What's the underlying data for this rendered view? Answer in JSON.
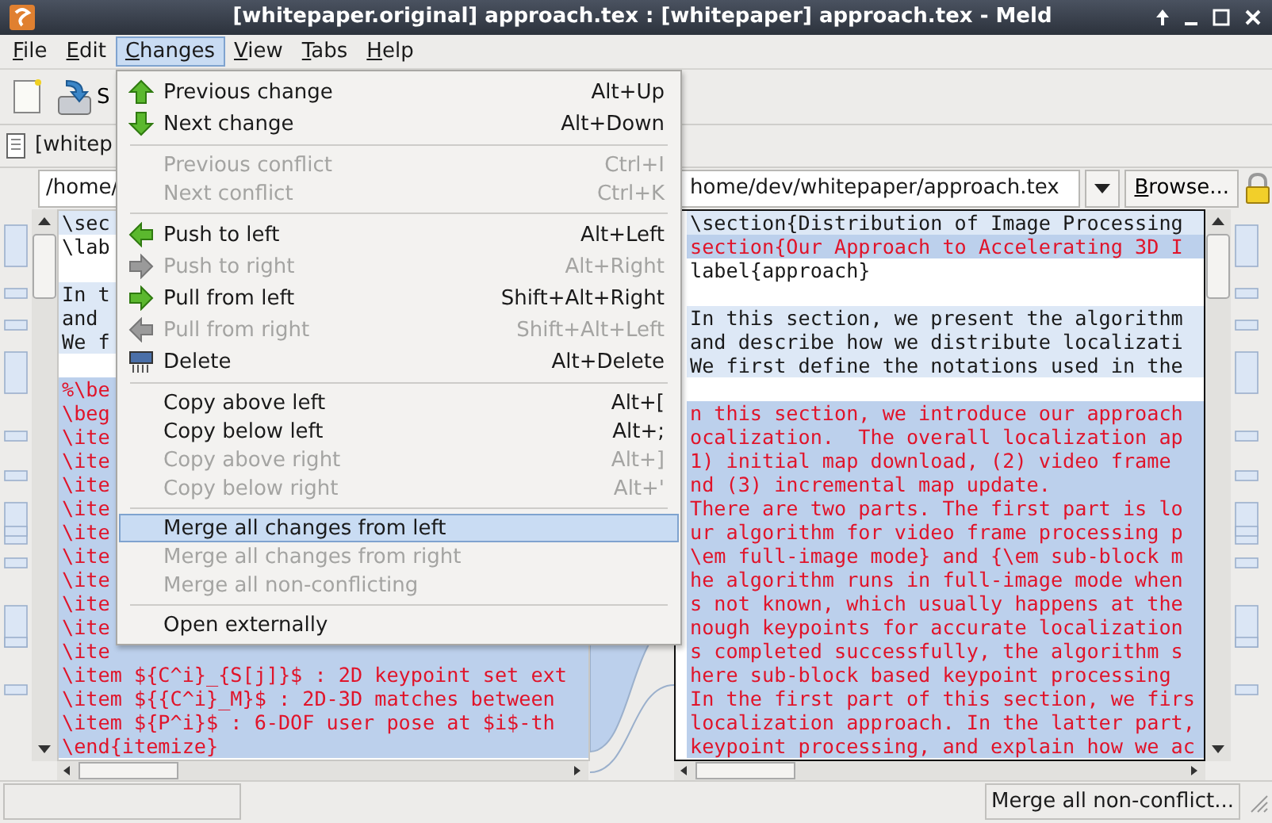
{
  "window": {
    "title": "[whitepaper.original] approach.tex : [whitepaper] approach.tex - Meld"
  },
  "menubar": [
    {
      "label": "File",
      "selected": false
    },
    {
      "label": "Edit",
      "selected": false
    },
    {
      "label": "Changes",
      "selected": true
    },
    {
      "label": "View",
      "selected": false
    },
    {
      "label": "Tabs",
      "selected": false
    },
    {
      "label": "Help",
      "selected": false
    }
  ],
  "toolbar": {
    "save_label": "S"
  },
  "tab": {
    "label": "[whitep"
  },
  "left_pane": {
    "path": "/home/",
    "lines": [
      {
        "kind": "modified",
        "text": "\\sec"
      },
      {
        "kind": "plain",
        "text": "\\lab"
      },
      {
        "kind": "blank"
      },
      {
        "kind": "modified",
        "text": "In t"
      },
      {
        "kind": "modified",
        "text": "and"
      },
      {
        "kind": "modified",
        "text": "We f"
      },
      {
        "kind": "blank"
      },
      {
        "kind": "changed",
        "text": "%\\be"
      },
      {
        "kind": "changed",
        "text": "\\beg"
      },
      {
        "kind": "changed",
        "text": "\\ite"
      },
      {
        "kind": "changed",
        "text": "\\ite"
      },
      {
        "kind": "changed",
        "text": "\\ite"
      },
      {
        "kind": "changed",
        "text": "\\ite"
      },
      {
        "kind": "changed",
        "text": "\\ite"
      },
      {
        "kind": "changed",
        "text": "\\ite"
      },
      {
        "kind": "changed",
        "text": "\\ite"
      },
      {
        "kind": "changed",
        "text": "\\ite"
      },
      {
        "kind": "changed",
        "text": "\\ite"
      },
      {
        "kind": "changed",
        "text": "\\ite"
      },
      {
        "kind": "changed",
        "text": "\\item ${C^i}_{S[j]}$ : 2D keypoint set ext"
      },
      {
        "kind": "changed",
        "text": "\\item ${{C^i}_M}$ : 2D-3D matches between"
      },
      {
        "kind": "changed",
        "text": "\\item ${P^i}$ : 6-DOF user pose at $i$-th"
      },
      {
        "kind": "changed",
        "text": "\\end{itemize}"
      }
    ]
  },
  "right_pane": {
    "path": "home/dev/whitepaper/approach.tex",
    "browse": "Browse...",
    "lines": [
      {
        "kind": "modified",
        "text": "\\section{Distribution of Image Processing"
      },
      {
        "kind": "changed",
        "text": "section{Our Approach to Accelerating 3D I"
      },
      {
        "kind": "plain",
        "text": "label{approach}"
      },
      {
        "kind": "blank"
      },
      {
        "kind": "modified",
        "text": "In this section, we present the algorithm"
      },
      {
        "kind": "modified",
        "text": "and describe how we distribute localizati"
      },
      {
        "kind": "modified",
        "text": "We first define the notations used in the"
      },
      {
        "kind": "blank"
      },
      {
        "kind": "changed",
        "text": "n this section, we introduce our approach"
      },
      {
        "kind": "changed",
        "text": "ocalization.  The overall localization ap"
      },
      {
        "kind": "changed",
        "text": "1) initial map download, (2) video frame"
      },
      {
        "kind": "changed",
        "text": "nd (3) incremental map update."
      },
      {
        "kind": "changed",
        "text": "There are two parts. The first part is lo"
      },
      {
        "kind": "changed",
        "text": "ur algorithm for video frame processing p"
      },
      {
        "kind": "changed",
        "text": "\\em full-image mode} and {\\em sub-block m"
      },
      {
        "kind": "changed",
        "text": "he algorithm runs in full-image mode when"
      },
      {
        "kind": "changed",
        "text": "s not known, which usually happens at the"
      },
      {
        "kind": "changed",
        "text": "nough keypoints for accurate localization"
      },
      {
        "kind": "changed",
        "text": "s completed successfully, the algorithm s"
      },
      {
        "kind": "changed",
        "text": "here sub-block based keypoint processing"
      },
      {
        "kind": "changed",
        "text": "In the first part of this section, we firs"
      },
      {
        "kind": "changed",
        "text": "localization approach. In the latter part,"
      },
      {
        "kind": "changed",
        "text": "keypoint processing, and explain how we ac"
      }
    ]
  },
  "menu": {
    "items": [
      {
        "kind": "item",
        "label": "Previous change",
        "shortcut": "Alt+Up",
        "disabled": false,
        "selected": false
      },
      {
        "kind": "item",
        "label": "Next change",
        "shortcut": "Alt+Down",
        "disabled": false,
        "selected": false
      },
      {
        "kind": "separator"
      },
      {
        "kind": "item",
        "label": "Previous conflict",
        "shortcut": "Ctrl+I",
        "disabled": true,
        "selected": false
      },
      {
        "kind": "item",
        "label": "Next conflict",
        "shortcut": "Ctrl+K",
        "disabled": true,
        "selected": false
      },
      {
        "kind": "separator"
      },
      {
        "kind": "item",
        "label": "Push to left",
        "shortcut": "Alt+Left",
        "disabled": false,
        "selected": false
      },
      {
        "kind": "item",
        "label": "Push to right",
        "shortcut": "Alt+Right",
        "disabled": true,
        "selected": false
      },
      {
        "kind": "item",
        "label": "Pull from left",
        "shortcut": "Shift+Alt+Right",
        "disabled": false,
        "selected": false
      },
      {
        "kind": "item",
        "label": "Pull from right",
        "shortcut": "Shift+Alt+Left",
        "disabled": true,
        "selected": false
      },
      {
        "kind": "item",
        "label": "Delete",
        "shortcut": "Alt+Delete",
        "disabled": false,
        "selected": false
      },
      {
        "kind": "separator"
      },
      {
        "kind": "item",
        "label": "Copy above left",
        "shortcut": "Alt+[",
        "disabled": false,
        "selected": false
      },
      {
        "kind": "item",
        "label": "Copy below left",
        "shortcut": "Alt+;",
        "disabled": false,
        "selected": false
      },
      {
        "kind": "item",
        "label": "Copy above right",
        "shortcut": "Alt+]",
        "disabled": true,
        "selected": false
      },
      {
        "kind": "item",
        "label": "Copy below right",
        "shortcut": "Alt+'",
        "disabled": true,
        "selected": false
      },
      {
        "kind": "separator"
      },
      {
        "kind": "item",
        "label": "Merge all changes from left",
        "disabled": false,
        "selected": true
      },
      {
        "kind": "item",
        "label": "Merge all changes from right",
        "disabled": true,
        "selected": false
      },
      {
        "kind": "item",
        "label": "Merge all non-conflicting",
        "disabled": true,
        "selected": false
      },
      {
        "kind": "separator"
      },
      {
        "kind": "item",
        "label": "Open externally",
        "disabled": false,
        "selected": false
      }
    ]
  },
  "status_bar": {
    "message": "Merge all non-conflict..."
  }
}
